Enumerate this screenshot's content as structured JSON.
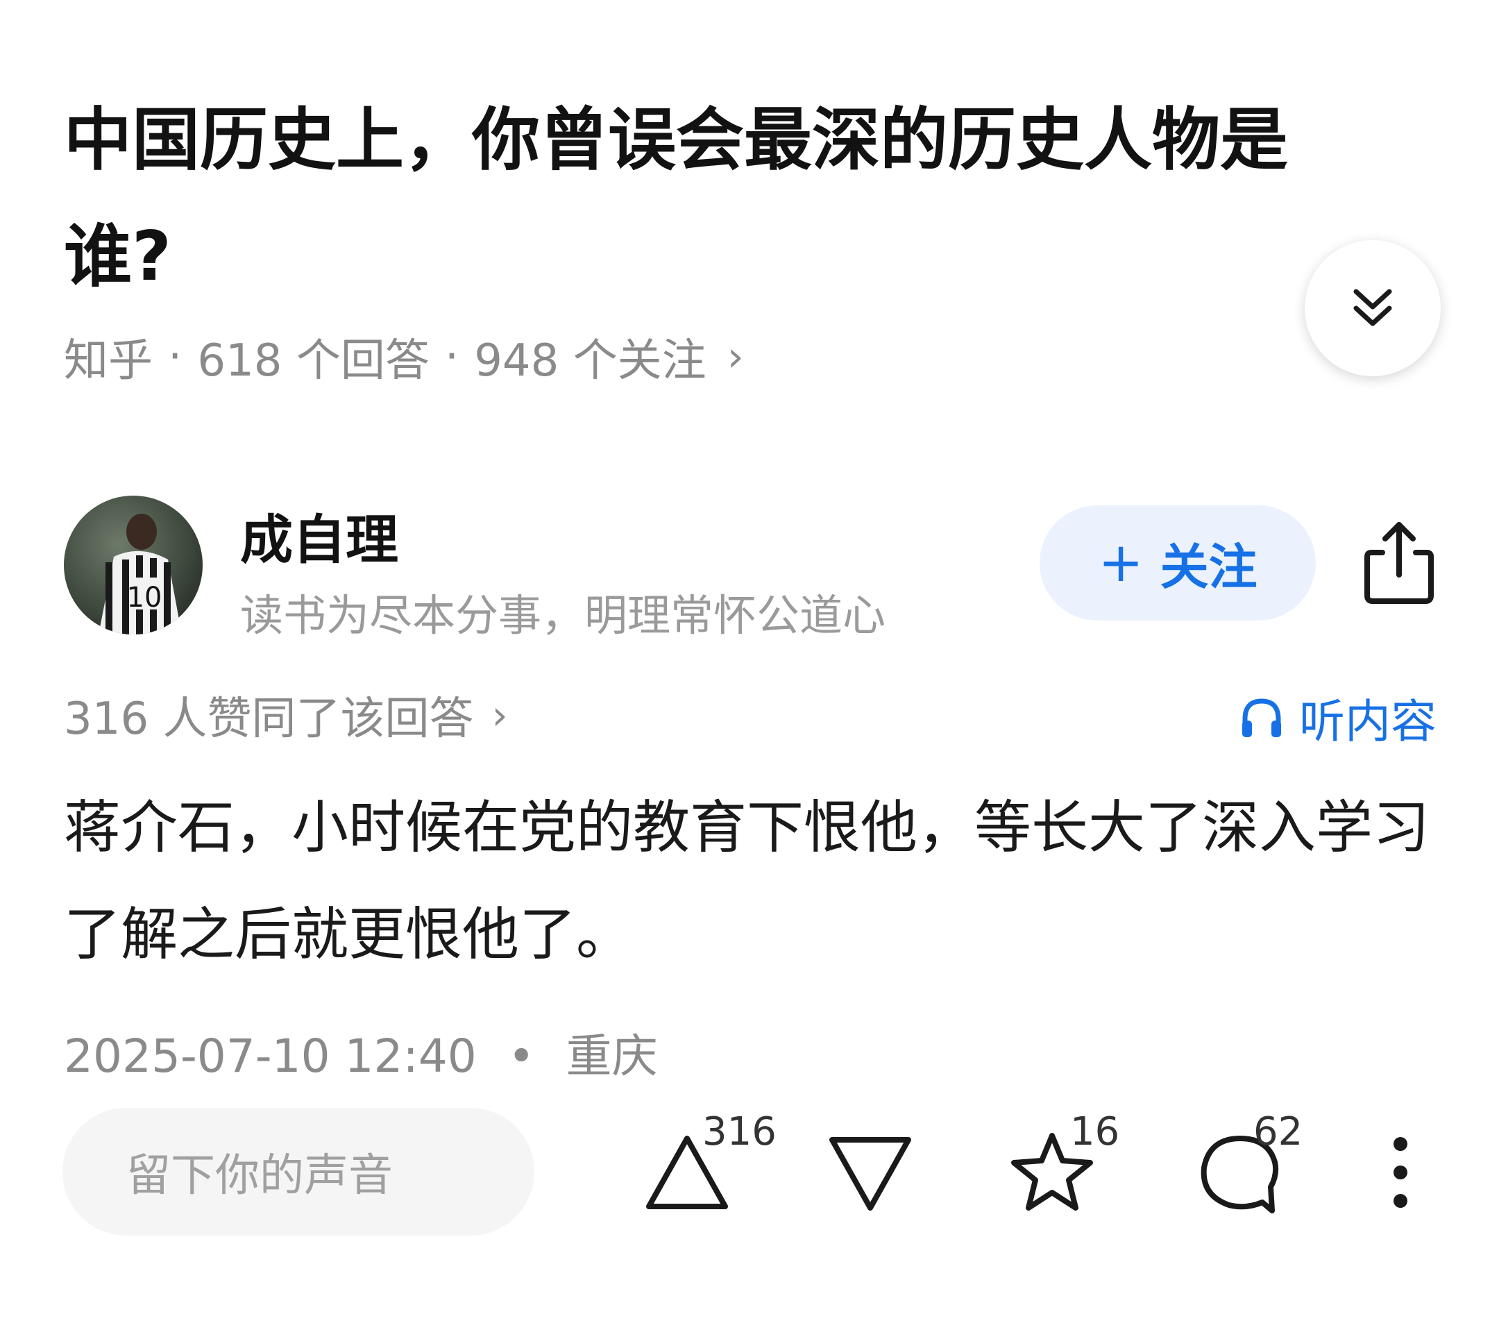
{
  "question": {
    "title": "中国历史上，你曾误会最深的历史人物是谁?",
    "source": "知乎",
    "answers": "618 个回答",
    "followers": "948 个关注"
  },
  "author": {
    "name": "成自理",
    "bio": "读书为尽本分事，明理常怀公道心",
    "avatar_icon": "avatar-photo"
  },
  "follow_button": {
    "plus": "+",
    "label": "关注"
  },
  "vote_summary": "316 人赞同了该回答",
  "listen_label": "听内容",
  "answer": {
    "text": "蒋介石，小时候在党的教育下恨他，等长大了深入学习了解之后就更恨他了。",
    "datetime": "2025-07-10 12:40",
    "location": "重庆"
  },
  "actions": {
    "comment_placeholder": "留下你的声音",
    "upvotes": "316",
    "favorites": "16",
    "comments": "62"
  },
  "colors": {
    "accent": "#1771e6",
    "follow_bg": "#ebf2fd",
    "muted": "#8a8a8a"
  }
}
